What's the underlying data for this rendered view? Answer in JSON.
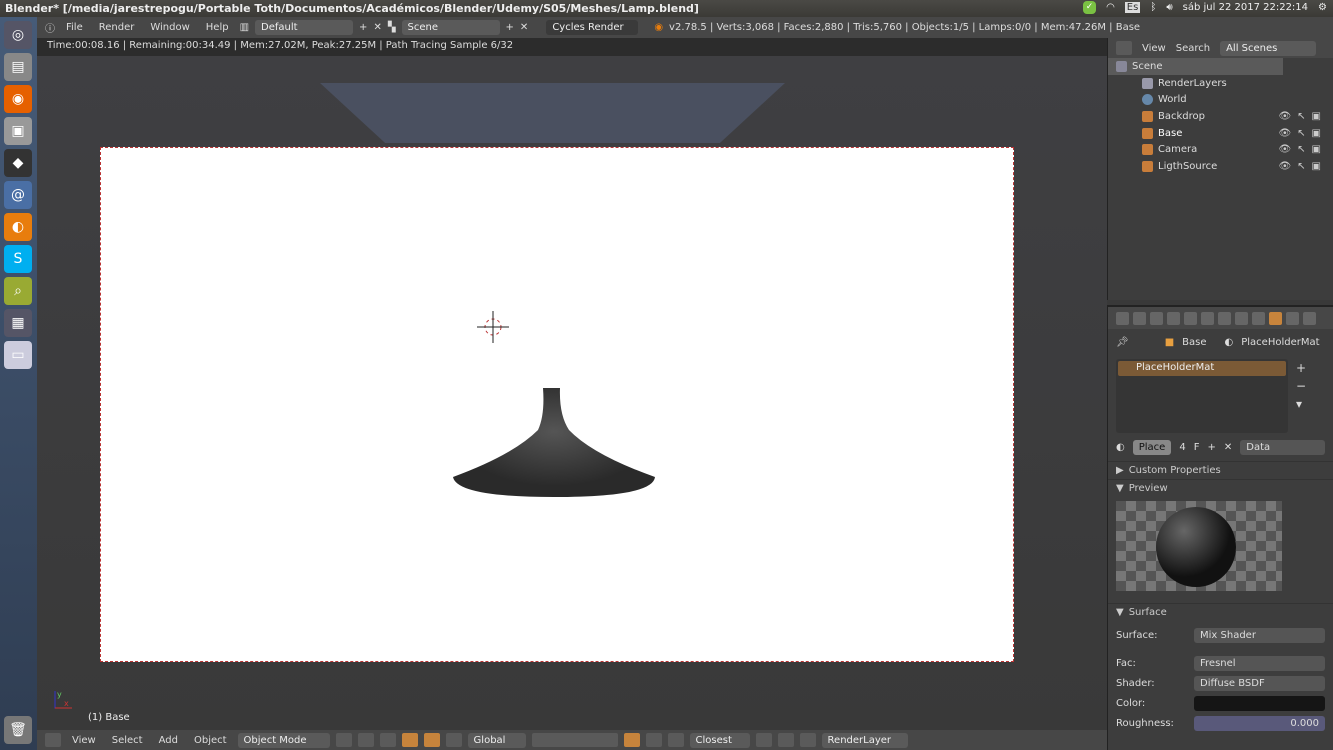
{
  "os": {
    "window_title": "Blender* [/media/jarestrepogu/Portable Toth/Documentos/Académicos/Blender/Udemy/S05/Meshes/Lamp.blend]",
    "keyboard": "Es",
    "clock": "sáb jul 22 2017 22:22:14"
  },
  "info_header": {
    "menus": [
      "File",
      "Render",
      "Window",
      "Help"
    ],
    "screen_layout": "Default",
    "scene": "Scene",
    "engine": "Cycles Render",
    "stats": "v2.78.5 | Verts:3,068 | Faces:2,880 | Tris:5,760 | Objects:1/5 | Lamps:0/0 | Mem:47.26M | Base"
  },
  "render_status": "Time:00:08.16 | Remaining:00:34.49 | Mem:27.02M, Peak:27.25M | Path Tracing Sample 6/32",
  "viewport": {
    "object_label": "(1) Base",
    "axis_x": "x",
    "axis_y": "y"
  },
  "bottom_header": {
    "menus": [
      "View",
      "Select",
      "Add",
      "Object"
    ],
    "mode": "Object Mode",
    "orientation": "Global",
    "snap": "Closest",
    "render_layer": "RenderLayer"
  },
  "outliner": {
    "menus": [
      "View",
      "Search"
    ],
    "filter": "All Scenes",
    "items": [
      "Scene",
      "RenderLayers",
      "World",
      "Backdrop",
      "Base",
      "Camera",
      "LigthSource"
    ]
  },
  "properties": {
    "breadcrumb": [
      "Base",
      "PlaceHolderMat"
    ],
    "material_slot": "PlaceHolderMat",
    "mat_name": "Place",
    "users": "4",
    "fake": "F",
    "link": "Data",
    "panels": {
      "custom": "Custom Properties",
      "preview": "Preview",
      "surface": "Surface"
    },
    "surface": {
      "surface_label": "Surface:",
      "surface_value": "Mix Shader",
      "fac_label": "Fac:",
      "fac_value": "Fresnel",
      "shader_label": "Shader:",
      "shader_value": "Diffuse BSDF",
      "color_label": "Color:",
      "roughness_label": "Roughness:",
      "roughness_value": "0.000"
    }
  }
}
